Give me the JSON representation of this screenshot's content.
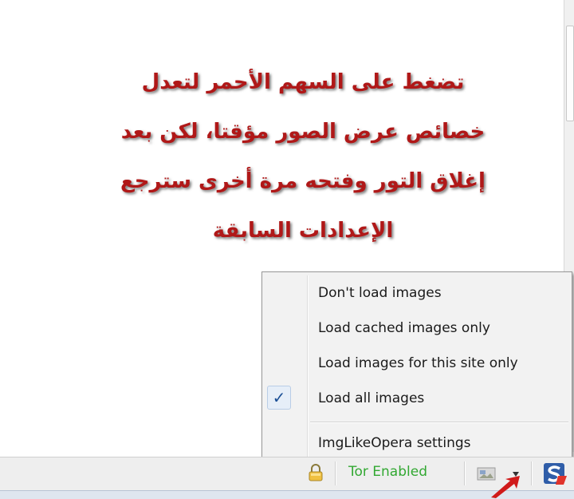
{
  "annotation": {
    "lines": [
      "تضغط على السهم الأحمر لتعدل",
      "خصائص عرض الصور مؤقتا، لكن بعد",
      "إغلاق التور وفتحه مرة أخرى سترجع",
      "الإعدادات السابقة"
    ],
    "color": "#b01818"
  },
  "menu": {
    "items": [
      {
        "label": "Don't load images",
        "checked": false
      },
      {
        "label": "Load cached images only",
        "checked": false
      },
      {
        "label": "Load images for this site only",
        "checked": false
      },
      {
        "label": "Load all images",
        "checked": true
      }
    ],
    "settings_label": "ImgLikeOpera settings",
    "check_glyph": "✓"
  },
  "statusbar": {
    "tor_label": "Tor Enabled",
    "tor_color": "#32a832",
    "icons": [
      "lock-icon",
      "image-icon",
      "dropdown-arrow-icon",
      "s-logo-icon"
    ]
  }
}
